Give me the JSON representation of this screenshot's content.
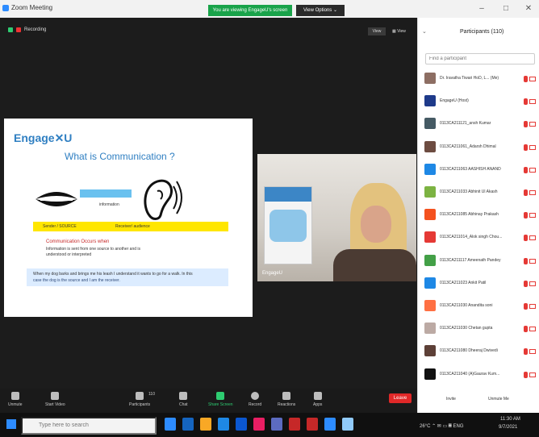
{
  "window": {
    "title": "Zoom Meeting",
    "share_banner": "You are viewing EngageU's screen",
    "view_options": "View Options ⌄",
    "minimize": "–",
    "maximize": "□",
    "close": "✕"
  },
  "meeting": {
    "recording_label": "Recording",
    "view_btn": "View",
    "grid_btn": "▦ View"
  },
  "slide": {
    "logo": "Engage✕U",
    "title": "What is Communication ?",
    "arrow_label": "information",
    "yellow_left": "Sender / SOURCE",
    "yellow_right": "Receiver/ audience",
    "heading": "Communication Occurs when",
    "line1": "Information is sent from one source to another and is",
    "line2": "understood or interpreted",
    "blue_line1": "When my dog barks and brings me his leash I understand it wants to go for a walk. In this",
    "blue_line2": "case the dog is the source and I am the receiver."
  },
  "video": {
    "name": "EngageU"
  },
  "toolbar": {
    "items": [
      {
        "label": "Unmute"
      },
      {
        "label": "Start Video"
      },
      {
        "label": "Participants"
      },
      {
        "label": "Chat"
      },
      {
        "label": "Share Screen"
      },
      {
        "label": "Record"
      },
      {
        "label": "Reactions"
      },
      {
        "label": "Apps"
      }
    ],
    "participant_count": "110",
    "leave": "Leave"
  },
  "panel": {
    "title": "Participants (110)",
    "back": "⌄",
    "search_placeholder": "Find a participant",
    "participants": [
      {
        "name": "Dr. Iravatha Tiwari HoD, L... (Me)",
        "color": "#8d6e63"
      },
      {
        "name": "EngageU (Host)",
        "color": "#1e3a8a"
      },
      {
        "name": "0113CA211121_ansh Kumar",
        "color": "#455a64"
      },
      {
        "name": "0113CA211061_Adarsh Dhimal",
        "color": "#6d4c41"
      },
      {
        "name": "0113CA211063 AASHISH ANAND",
        "color": "#1e88e5"
      },
      {
        "name": "0113CA211033 Abhinit Ul Akash",
        "color": "#7cb342"
      },
      {
        "name": "0113CA211085 Abhinay Prakash",
        "color": "#f4511e"
      },
      {
        "name": "0113CA211014_Alok singh Chou...",
        "color": "#e53935"
      },
      {
        "name": "0113CA211117 Ameenath Pandey",
        "color": "#43a047"
      },
      {
        "name": "0113CA211023 Ankit Patil",
        "color": "#1e88e5"
      },
      {
        "name": "0113CA211030 Anandita soni",
        "color": "#ff7043"
      },
      {
        "name": "0113CA211030 Chetan gupta",
        "color": "#bcaaa4"
      },
      {
        "name": "0113CA211080 Dheeraj Dwivedi",
        "color": "#5d4037"
      },
      {
        "name": "0113CA211040 (A)Gaurav Kum...",
        "color": "#111111"
      }
    ],
    "invite": "Invite",
    "unmute_me": "Unmute Me"
  },
  "taskbar": {
    "search_placeholder": "Type here to search",
    "weather": "26°C ⌃ ✉ ▭ 𝄜 ENG",
    "time": "11:30 AM",
    "date": "9/7/2021",
    "icons": [
      "#2d8cff",
      "#1565c0",
      "#f9a825",
      "#1e88e5",
      "#0b57d0",
      "#e91e63",
      "#5c6bc0",
      "#c62828",
      "#c62828",
      "#2d8cff",
      "#90caf9"
    ]
  }
}
